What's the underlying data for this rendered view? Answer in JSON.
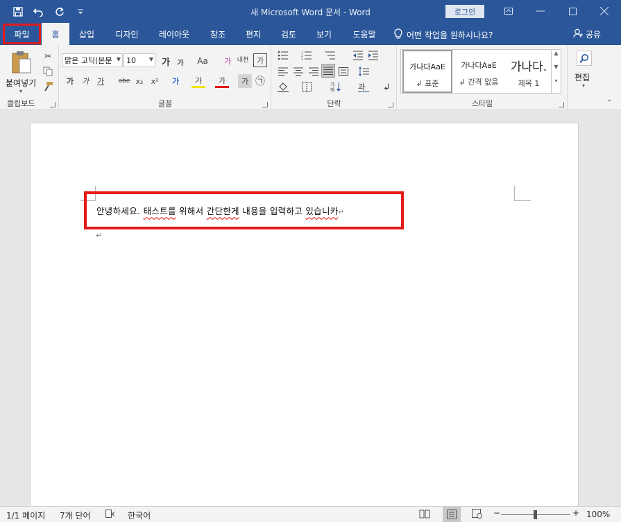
{
  "window": {
    "title": "새 Microsoft Word 문서  -  Word",
    "login": "로그인"
  },
  "qat": {
    "save_icon": "save-icon",
    "undo_icon": "undo-icon",
    "redo_icon": "redo-icon",
    "customize_icon": "customize-icon"
  },
  "tabs": [
    "파일",
    "홈",
    "삽입",
    "디자인",
    "레이아웃",
    "참조",
    "편지",
    "검토",
    "보기",
    "도움말"
  ],
  "tell_me": "어떤 작업을 원하시나요?",
  "share": "공유",
  "ribbon": {
    "clipboard": {
      "paste": "붙여넣기",
      "label": "클립보드"
    },
    "font": {
      "name": "맑은 고딕(본문",
      "size": "10",
      "label": "글꼴",
      "grow": "가",
      "shrink": "가",
      "case": "Aa",
      "bold": "가",
      "italic": "가",
      "underline": "가",
      "strike": "abe",
      "subscript": "x₂",
      "superscript": "x²",
      "text_effects": "가",
      "highlight": "가",
      "font_color": "가",
      "shading": "가",
      "enclose": "㉠",
      "clear": "가",
      "phonetic": "내천",
      "border": "가"
    },
    "paragraph": {
      "label": "단락"
    },
    "styles": {
      "label": "스타일",
      "items": [
        {
          "sample": "가나다AaE",
          "name": "↲ 표준"
        },
        {
          "sample": "가나다AaE",
          "name": "↲ 간격 없음"
        },
        {
          "sample": "가나다.",
          "name": "제목 1"
        }
      ]
    },
    "editing": {
      "label": "편집"
    }
  },
  "document": {
    "line_prefix": "안녕하세요. ",
    "w1": "태스트를",
    "m1": " 위해서 ",
    "w2": "간단한게",
    "m2": " 내용을 입력하고 ",
    "w3": "있습니카",
    "pilcrow": "↵",
    "second_para": "↵"
  },
  "status": {
    "page": "1/1 페이지",
    "words": "7개 단어",
    "language": "한국어",
    "zoom": "100%",
    "minus": "−",
    "plus": "+"
  },
  "colors": {
    "brand": "#2b579a",
    "annotation": "#e41a1a"
  }
}
